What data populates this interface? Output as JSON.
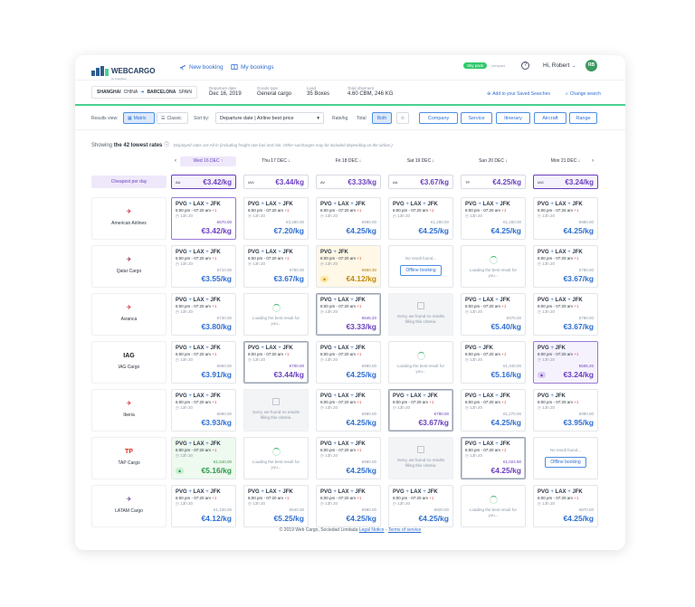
{
  "header": {
    "logo_text": "WEBCARGO",
    "logo_sub": "by Freightos",
    "nav_new": "New booking",
    "nav_my": "My bookings",
    "skypack": "Sky pack",
    "compact": "compact",
    "help": "?",
    "greeting": "Hi, Robert",
    "avatar": "RB"
  },
  "search": {
    "origin": "SHANGHAI",
    "origin_country": "CHINA",
    "destination": "BARCELONA",
    "destination_country": "SPAIN",
    "departure_label": "Departure date",
    "departure_value": "Dec 16, 2019",
    "goods_label": "Goods type",
    "goods_value": "General cargo",
    "load_label": "Load",
    "load_value": "35 Boxes",
    "total_label": "Total shipment",
    "total_value": "4.60 CBM, 246 KG",
    "save_link": "Add to your Saved Searches",
    "change_link": "Change search"
  },
  "filters": {
    "results_view": "Results view:",
    "matrix": "Matrix",
    "classic": "Classic",
    "sort_by": "Sort by:",
    "sort_value": "Departure date | Airline best price",
    "rate_kg": "Rate/kg",
    "total": "Total",
    "both": "Both",
    "buttons": [
      "Company",
      "Service",
      "Itinerary",
      "Aircraft",
      "Range"
    ]
  },
  "summary": {
    "showing_prefix": "Showing",
    "showing_bold": "the 42 lowest rates",
    "note": "Displayed rates are All-in (including freight rate fuel and risk. Other surcharges may be included depending on the airline.)"
  },
  "dates": [
    "Wed 16 DEC",
    "Thu 17 DEC",
    "Fri 18 DEC",
    "Sat 19 DEC",
    "Sun 20 DEC",
    "Mon 21 DEC"
  ],
  "nav_prev": "‹",
  "nav_next": "›",
  "cheapest": {
    "label": "Cheapest per day",
    "values": [
      "€3.42/kg",
      "€3.44/kg",
      "€3.33/kg",
      "€3.67/kg",
      "€4.25/kg",
      "€3.24/kg"
    ],
    "carriers": [
      "AA",
      "IAG",
      "AV",
      "AA",
      "TP",
      "IAG"
    ]
  },
  "airlines": [
    "American Airlines",
    "Qatar Cargo",
    "Avianca",
    "IAG Cargo",
    "Iberia",
    "TAP Cargo",
    "LATAM Cargo"
  ],
  "airline_logos": [
    "✈",
    "✈",
    "✈",
    "IAG",
    "✈",
    "TP",
    "✈"
  ],
  "strings": {
    "loading": "Loading the best result for you...",
    "sorry": "Sorry, we found no results filling this criteria.",
    "no_result": "No result found...",
    "offline": "Offline booking",
    "duration": "13h 20",
    "time": "6:00 pm - 07:20 am",
    "plus": "+1",
    "p1": "PVG",
    "p2": "LAX",
    "p3": "JFK",
    "sep": "+"
  },
  "rows": [
    [
      {
        "kind": "rate",
        "route": 3,
        "total": "€670.00",
        "price": "€3.42/kg",
        "style": "best",
        "pcolor": "pur",
        "tcolor": "dark"
      },
      {
        "kind": "rate",
        "route": 3,
        "total": "€3,280.00",
        "price": "€7.20/kg",
        "style": "",
        "pcolor": "",
        "tcolor": ""
      },
      {
        "kind": "rate",
        "route": 3,
        "total": "€980.00",
        "price": "€4.25/kg",
        "style": "",
        "pcolor": "",
        "tcolor": ""
      },
      {
        "kind": "rate",
        "route": 3,
        "total": "€1,280.00",
        "price": "€4.25/kg",
        "style": "",
        "pcolor": "",
        "tcolor": ""
      },
      {
        "kind": "rate",
        "route": 3,
        "total": "€1,280.00",
        "price": "€4.25/kg",
        "style": "",
        "pcolor": "",
        "tcolor": ""
      },
      {
        "kind": "rate",
        "route": 3,
        "total": "€980.00",
        "price": "€4.25/kg",
        "style": "",
        "pcolor": "",
        "tcolor": ""
      }
    ],
    [
      {
        "kind": "rate",
        "route": 3,
        "total": "€710.00",
        "price": "€3.55/kg",
        "style": "",
        "pcolor": "",
        "tcolor": ""
      },
      {
        "kind": "rate",
        "route": 3,
        "total": "€780.00",
        "price": "€3.67/kg",
        "style": "",
        "pcolor": "",
        "tcolor": ""
      },
      {
        "kind": "rate",
        "route": 2,
        "total": "€950.30",
        "price": "€4.12/kg",
        "style": "yellow",
        "pcolor": "gold",
        "tcolor": "brown",
        "badge": "yellow"
      },
      {
        "kind": "noresult"
      },
      {
        "kind": "loading"
      },
      {
        "kind": "rate",
        "route": 3,
        "total": "€780.00",
        "price": "€3.67/kg",
        "style": "",
        "pcolor": "",
        "tcolor": ""
      }
    ],
    [
      {
        "kind": "rate",
        "route": 3,
        "total": "€730.00",
        "price": "€3.80/kg",
        "style": "",
        "pcolor": "",
        "tcolor": ""
      },
      {
        "kind": "loading"
      },
      {
        "kind": "rate",
        "route": 3,
        "total": "€545.20",
        "price": "€3.33/kg",
        "style": "sel2",
        "pcolor": "pur",
        "tcolor": "dark"
      },
      {
        "kind": "sorry"
      },
      {
        "kind": "rate",
        "route": 3,
        "total": "€970.00",
        "price": "€5.40/kg",
        "style": "",
        "pcolor": "",
        "tcolor": ""
      },
      {
        "kind": "rate",
        "route": 3,
        "total": "€780.00",
        "price": "€3.67/kg",
        "style": "",
        "pcolor": "",
        "tcolor": ""
      }
    ],
    [
      {
        "kind": "rate",
        "route": 3,
        "total": "€860.00",
        "price": "€3.91/kg",
        "style": "",
        "pcolor": "",
        "tcolor": ""
      },
      {
        "kind": "rate",
        "route": 3,
        "total": "€700.00",
        "price": "€3.44/kg",
        "style": "sel2",
        "pcolor": "pur",
        "tcolor": "dark"
      },
      {
        "kind": "rate",
        "route": 3,
        "total": "€980.00",
        "price": "€4.25/kg",
        "style": "",
        "pcolor": "",
        "tcolor": ""
      },
      {
        "kind": "loading"
      },
      {
        "kind": "rate",
        "route": 2,
        "total": "€1,340.00",
        "price": "€5.16/kg",
        "style": "",
        "pcolor": "",
        "tcolor": ""
      },
      {
        "kind": "rate",
        "route": 2,
        "total": "€505.20",
        "price": "€3.24/kg",
        "style": "bestpurple",
        "pcolor": "pur",
        "tcolor": "dark",
        "badge": "purple"
      }
    ],
    [
      {
        "kind": "rate",
        "route": 3,
        "total": "€890.00",
        "price": "€3.93/kg",
        "style": "",
        "pcolor": "",
        "tcolor": ""
      },
      {
        "kind": "sorry"
      },
      {
        "kind": "rate",
        "route": 3,
        "total": "€980.00",
        "price": "€4.25/kg",
        "style": "",
        "pcolor": "",
        "tcolor": ""
      },
      {
        "kind": "rate",
        "route": 3,
        "total": "€780.00",
        "price": "€3.67/kg",
        "style": "sel2",
        "pcolor": "pur",
        "tcolor": "dark"
      },
      {
        "kind": "rate",
        "route": 3,
        "total": "€1,270.00",
        "price": "€4.25/kg",
        "style": "",
        "pcolor": "",
        "tcolor": ""
      },
      {
        "kind": "rate",
        "route": 2,
        "total": "€990.00",
        "price": "€3.95/kg",
        "style": "",
        "pcolor": "",
        "tcolor": ""
      }
    ],
    [
      {
        "kind": "rate",
        "route": 3,
        "total": "€1,540.00",
        "price": "€5.16/kg",
        "style": "green",
        "pcolor": "grn",
        "tcolor": "green",
        "badge": "green"
      },
      {
        "kind": "loading"
      },
      {
        "kind": "rate",
        "route": 3,
        "total": "€980.00",
        "price": "€4.25/kg",
        "style": "",
        "pcolor": "",
        "tcolor": ""
      },
      {
        "kind": "sorry"
      },
      {
        "kind": "rate",
        "route": 3,
        "total": "€1,024.90",
        "price": "€4.25/kg",
        "style": "sel2",
        "pcolor": "pur",
        "tcolor": "dark"
      },
      {
        "kind": "noresult"
      }
    ],
    [
      {
        "kind": "rate",
        "route": 3,
        "total": "€1,100.00",
        "price": "€4.12/kg",
        "style": "",
        "pcolor": "",
        "tcolor": ""
      },
      {
        "kind": "rate",
        "route": 3,
        "total": "€540.00",
        "price": "€5.25/kg",
        "style": "",
        "pcolor": "",
        "tcolor": ""
      },
      {
        "kind": "rate",
        "route": 3,
        "total": "€980.00",
        "price": "€4.25/kg",
        "style": "",
        "pcolor": "",
        "tcolor": ""
      },
      {
        "kind": "rate",
        "route": 3,
        "total": "€820.00",
        "price": "€4.25/kg",
        "style": "",
        "pcolor": "",
        "tcolor": ""
      },
      {
        "kind": "loading"
      },
      {
        "kind": "rate",
        "route": 3,
        "total": "€870.00",
        "price": "€4.25/kg",
        "style": "",
        "pcolor": "",
        "tcolor": ""
      }
    ]
  ],
  "footer": {
    "copyright": "© 2019 Web Cargo, Sociedad Limitada",
    "legal": "Legal Notice",
    "dash": "-",
    "terms": "Terms of service"
  },
  "colors": {
    "accent": "#2f6fd1",
    "purple": "#6a3fbf",
    "green": "#31c96b"
  }
}
